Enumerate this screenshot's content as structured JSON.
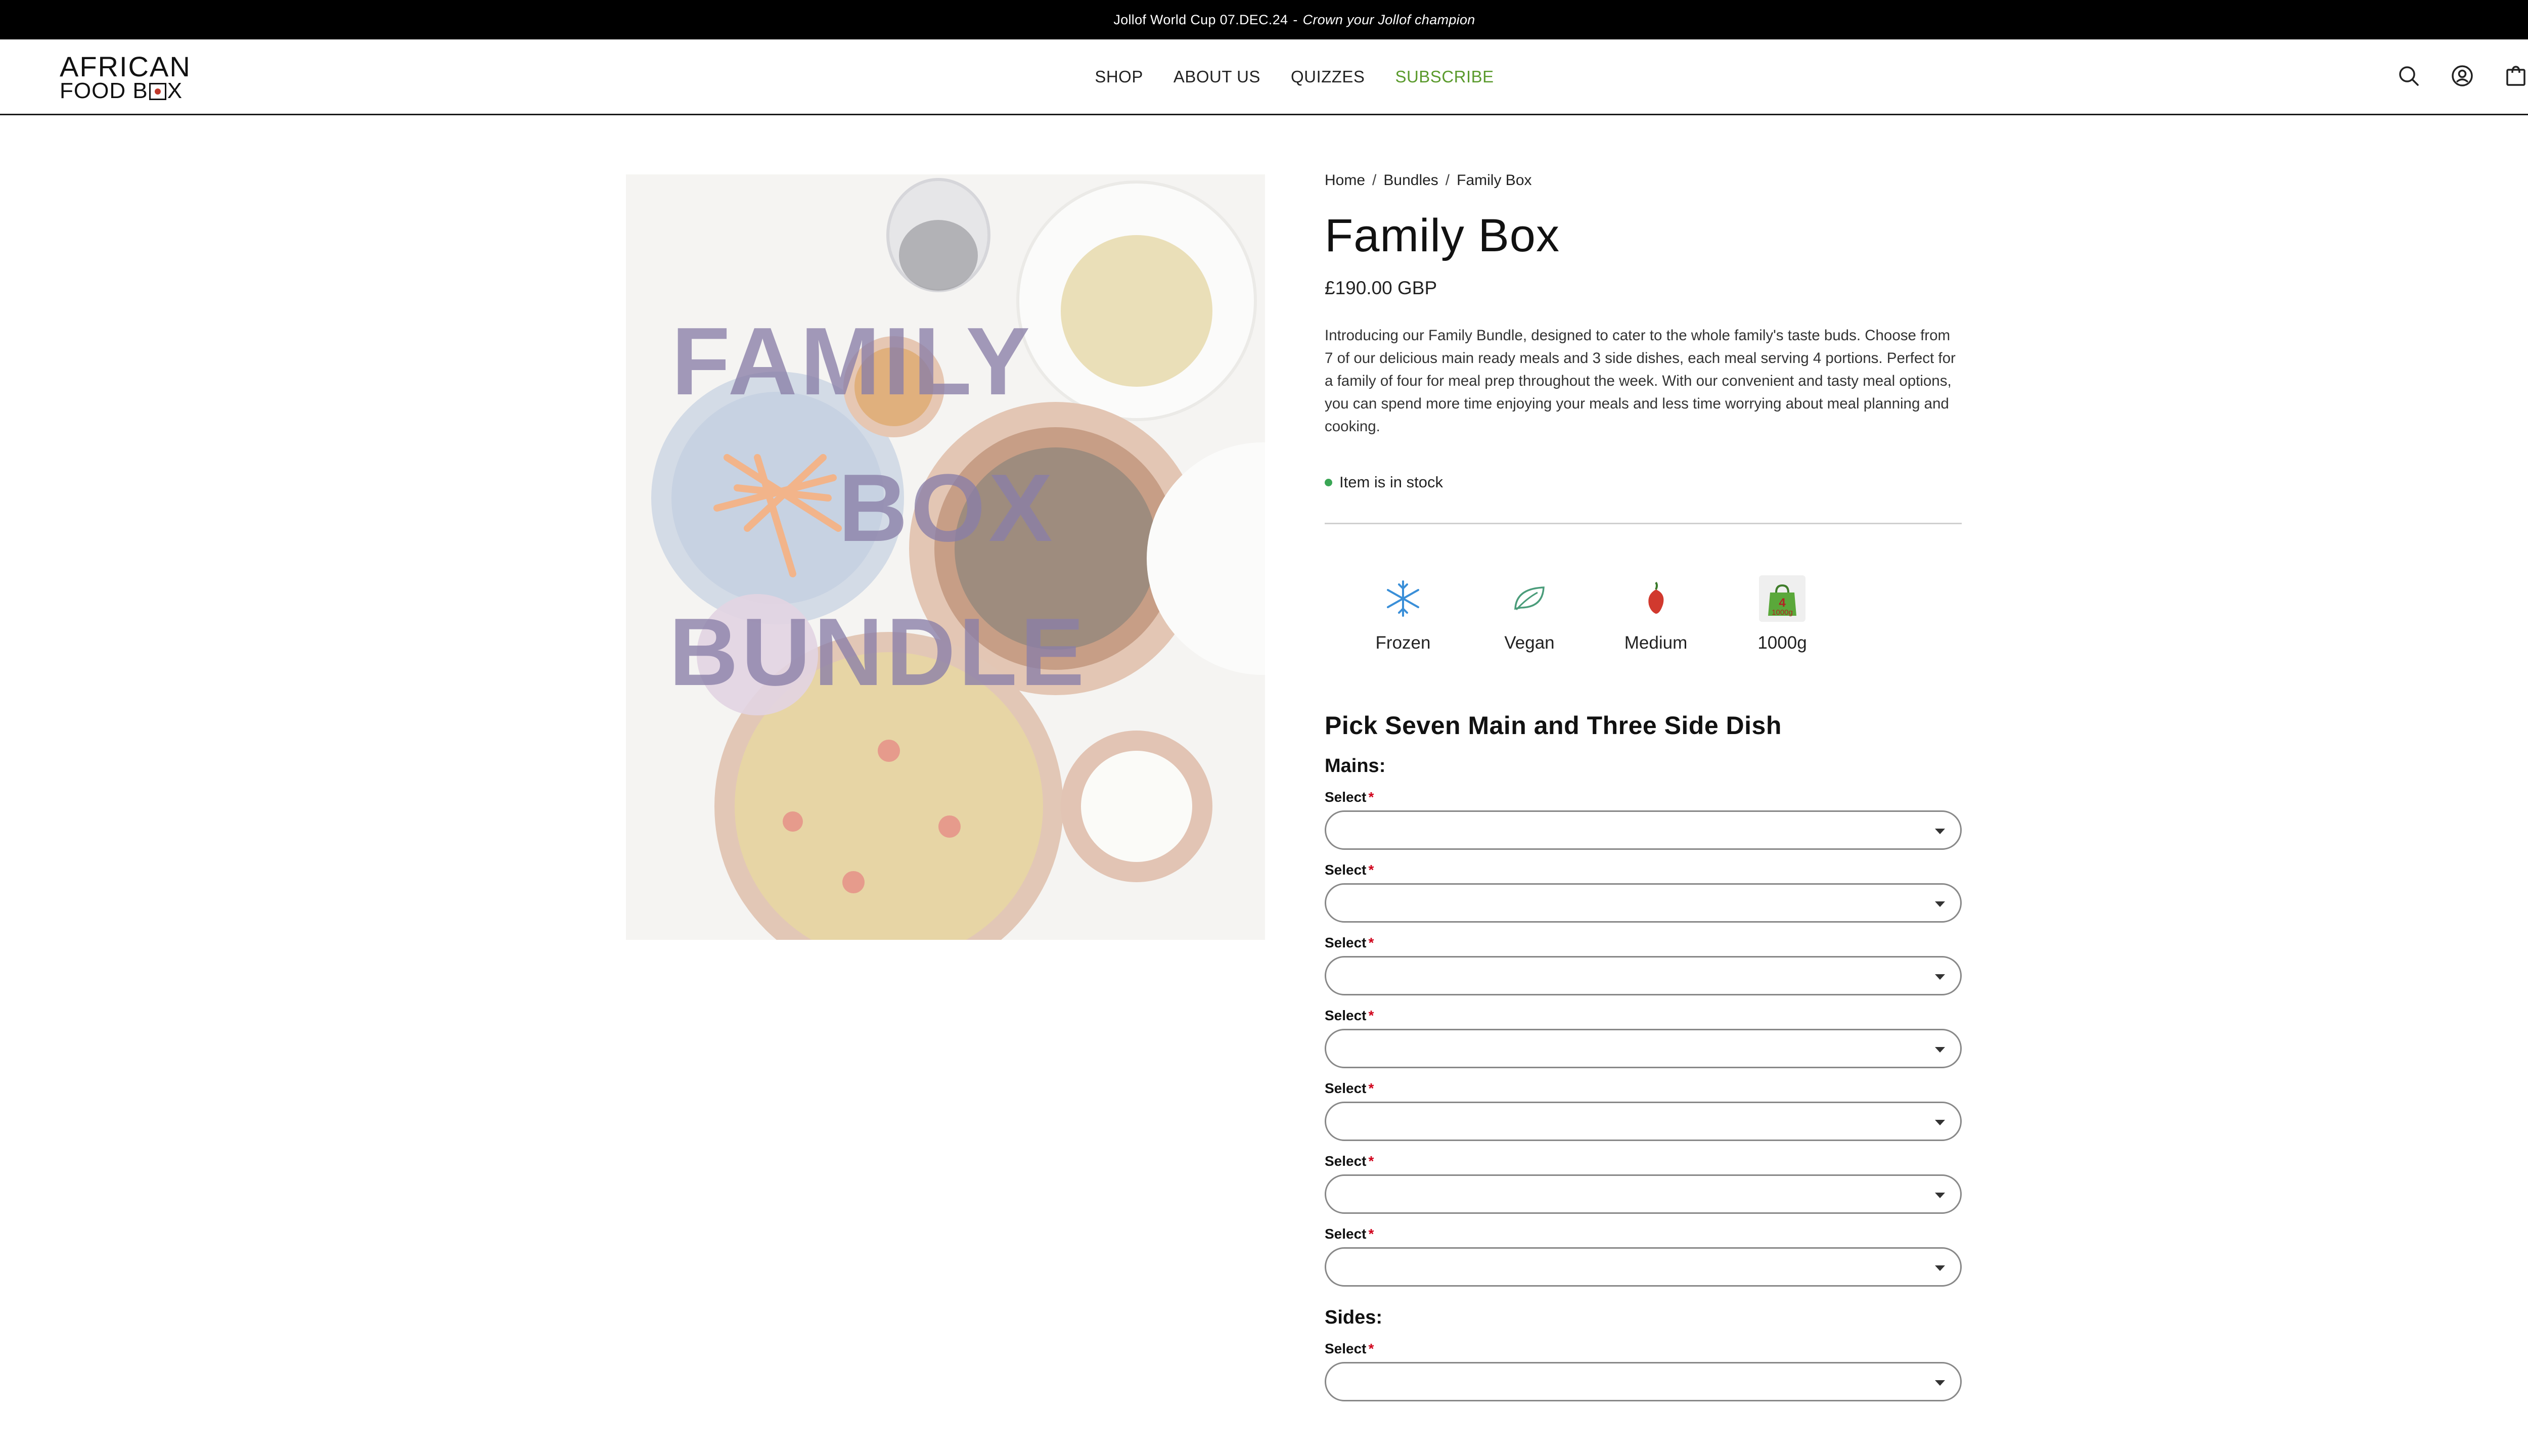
{
  "announcement": {
    "event": "Jollof World Cup 07.DEC.24",
    "separator": "-",
    "tagline": "Crown your Jollof champion"
  },
  "logo": {
    "line1": "AFRICAN",
    "line2a": "FOOD B",
    "line2b": "X"
  },
  "nav": {
    "items": [
      {
        "label": "SHOP"
      },
      {
        "label": "ABOUT US"
      },
      {
        "label": "QUIZZES"
      },
      {
        "label": "SUBSCRIBE"
      }
    ]
  },
  "header_icons": [
    "search-icon",
    "account-icon",
    "cart-bag-icon"
  ],
  "gallery": {
    "overlay_line1": "FAMILY",
    "overlay_line2": "BOX",
    "overlay_line3": "BUNDLE"
  },
  "breadcrumb": {
    "home": "Home",
    "bundles": "Bundles",
    "current": "Family Box",
    "separator": "/"
  },
  "product": {
    "title": "Family Box",
    "price": "£190.00 GBP",
    "description": "Introducing our Family Bundle, designed to cater to the whole family's taste buds. Choose from 7 of our delicious main ready meals and 3 side dishes, each meal serving 4 portions. Perfect for a family of four for meal prep throughout the week. With our convenient and tasty meal options, you can spend more time enjoying your meals and less time worrying about meal planning and cooking.",
    "stock": "Item is in stock",
    "stock_color": "#3aa655"
  },
  "features": [
    {
      "label": "Frozen",
      "icon": "snowflake-icon"
    },
    {
      "label": "Vegan",
      "icon": "leaf-icon"
    },
    {
      "label": "Medium",
      "icon": "chili-pepper-icon"
    },
    {
      "label": "1000g",
      "icon": "weight-bag-icon",
      "badge_top": "4",
      "badge_bottom": "1000g"
    }
  ],
  "picker": {
    "title": "Pick Seven Main and Three Side Dish",
    "mains_title": "Mains:",
    "sides_title": "Sides:",
    "select_label": "Select",
    "required_mark": "*"
  },
  "colors": {
    "accent_green": "#5a9a2c",
    "required_red": "#d0021b",
    "overlay_purple": "#8a7fa8"
  }
}
